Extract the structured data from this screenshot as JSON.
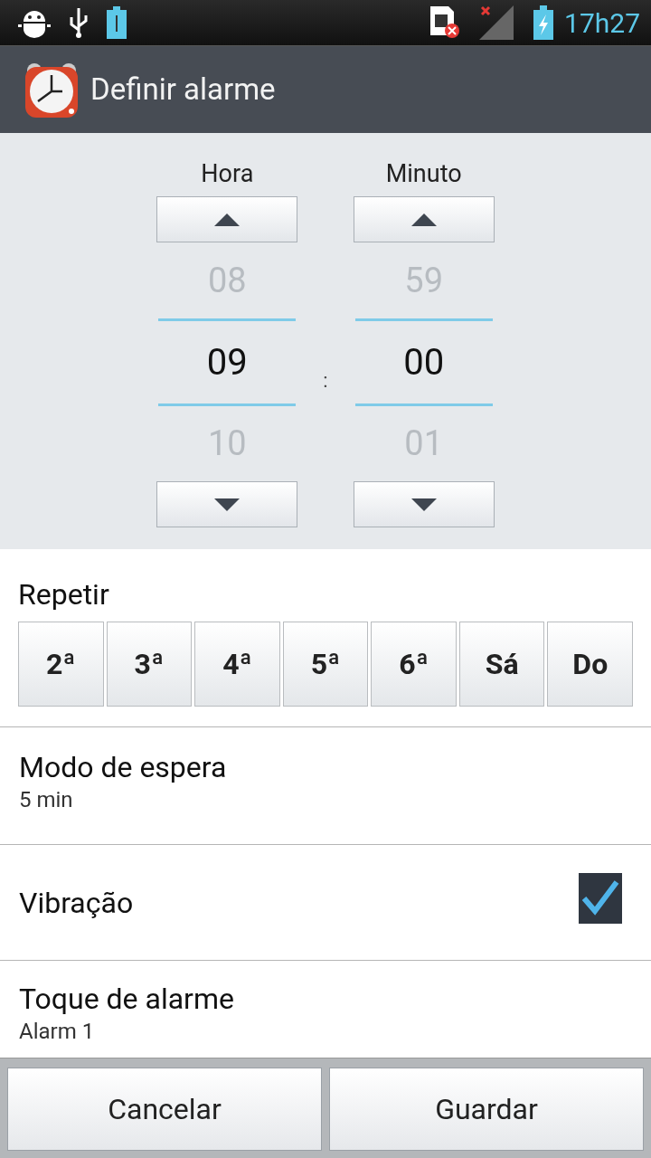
{
  "status_bar": {
    "time": "17h27"
  },
  "header": {
    "title": "Definir alarme"
  },
  "picker": {
    "columns": [
      {
        "label": "Hora",
        "previous": "08",
        "current": "09",
        "next": "10"
      },
      {
        "label": "Minuto",
        "previous": "59",
        "current": "00",
        "next": "01"
      }
    ],
    "separator": ":"
  },
  "repeat": {
    "label": "Repetir",
    "days": [
      {
        "label": "2ª",
        "selected": false
      },
      {
        "label": "3ª",
        "selected": false
      },
      {
        "label": "4ª",
        "selected": false
      },
      {
        "label": "5ª",
        "selected": false
      },
      {
        "label": "6ª",
        "selected": false
      },
      {
        "label": "Sá",
        "selected": false
      },
      {
        "label": "Do",
        "selected": false
      }
    ]
  },
  "settings": [
    {
      "kind": "value",
      "title": "Modo de espera",
      "value": "5 min"
    },
    {
      "kind": "checkbox",
      "title": "Vibração",
      "checked": true
    },
    {
      "kind": "value",
      "title": "Toque de alarme",
      "value": "Alarm 1"
    }
  ],
  "buttons": [
    "Cancelar",
    "Guardar"
  ]
}
